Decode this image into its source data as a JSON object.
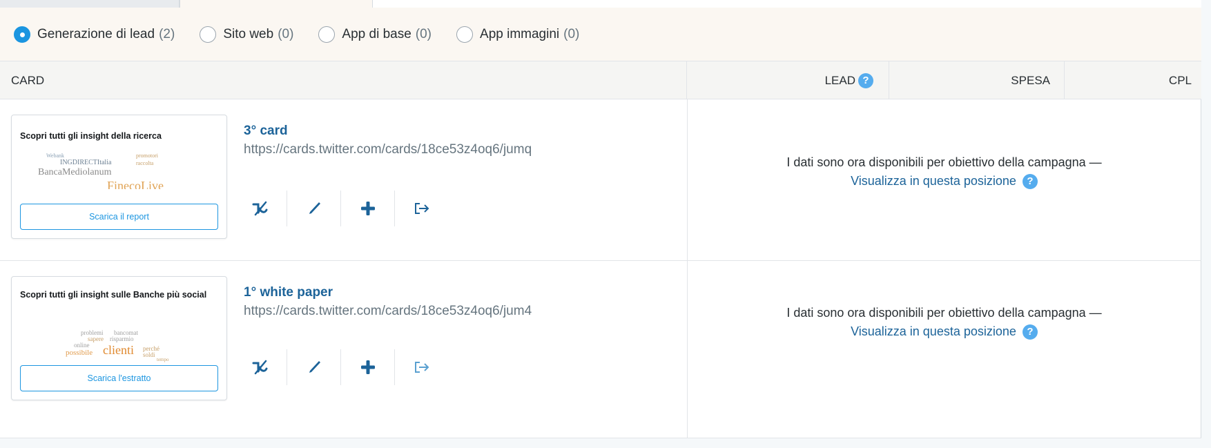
{
  "filters": [
    {
      "label": "Generazione di lead",
      "count": "(2)",
      "checked": true
    },
    {
      "label": "Sito web",
      "count": "(0)",
      "checked": false
    },
    {
      "label": "App di base",
      "count": "(0)",
      "checked": false
    },
    {
      "label": "App immagini",
      "count": "(0)",
      "checked": false
    }
  ],
  "table": {
    "headers": {
      "card": "CARD",
      "lead": "LEAD",
      "spesa": "SPESA",
      "cpl": "CPL"
    },
    "help_glyph": "?"
  },
  "rows": [
    {
      "thumb_title": "Scopri tutti gli insight della ricerca",
      "thumb_button": "Scarica il report",
      "cloud": [
        "INGDIRECTItalia",
        "BancaMediolanum",
        "FinecoLive",
        "raccolta",
        "Webank",
        "promotori"
      ],
      "name": "3° card",
      "url": "https://cards.twitter.com/cards/18ce53z4oq6/jumq",
      "message": "I dati sono ora disponibili per obiettivo della campagna —",
      "link": "Visualizza in questa posizione"
    },
    {
      "thumb_title": "Scopri tutti gli insight sulle Banche più social",
      "thumb_button": "Scarica l'estratto",
      "cloud": [
        "problemi",
        "bancomat",
        "sapere",
        "risparmio",
        "online",
        "possibile",
        "clienti",
        "perché",
        "soldi",
        "tempo"
      ],
      "name": "1° white paper",
      "url": "https://cards.twitter.com/cards/18ce53z4oq6/jum4",
      "message": "I dati sono ora disponibili per obiettivo della campagna —",
      "link": "Visualizza in questa posizione"
    }
  ],
  "icons": [
    "pause-icon",
    "edit-icon",
    "add-icon",
    "share-icon"
  ],
  "colors": {
    "accent": "#1b95e0",
    "link": "#1c6399",
    "help": "#55acee"
  }
}
